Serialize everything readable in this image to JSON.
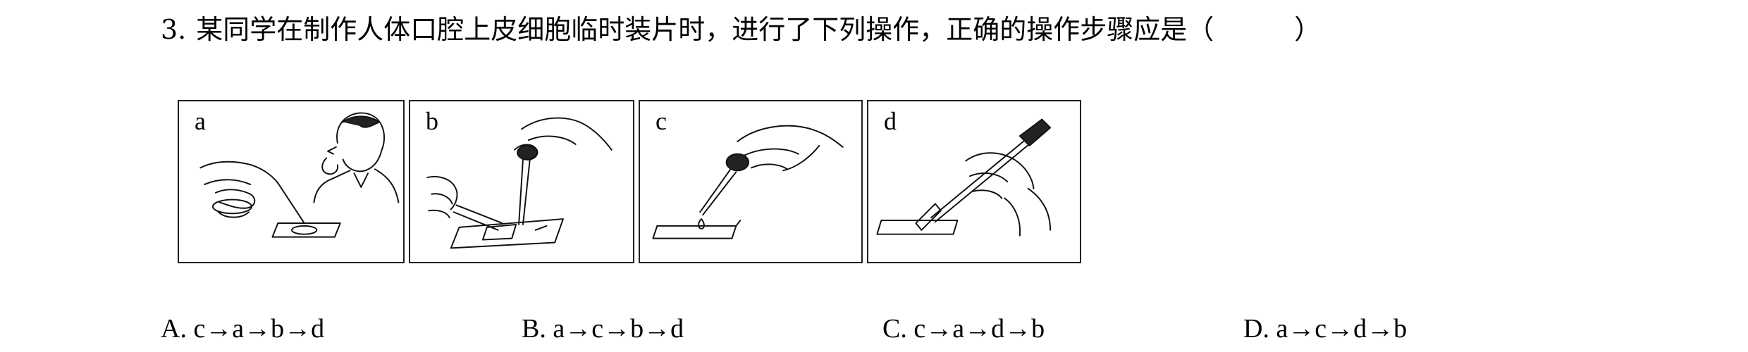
{
  "question": {
    "number": "3.",
    "text": "某同学在制作人体口腔上皮细胞临时装片时，进行了下列操作，正确的操作步骤应是（　　　）"
  },
  "figures": {
    "panels": [
      {
        "label": "a"
      },
      {
        "label": "b"
      },
      {
        "label": "c"
      },
      {
        "label": "d"
      }
    ]
  },
  "options": [
    {
      "text": "A. c→a→b→d"
    },
    {
      "text": "B. a→c→b→d"
    },
    {
      "text": "C. c→a→d→b"
    },
    {
      "text": "D. a→c→d→b"
    }
  ]
}
